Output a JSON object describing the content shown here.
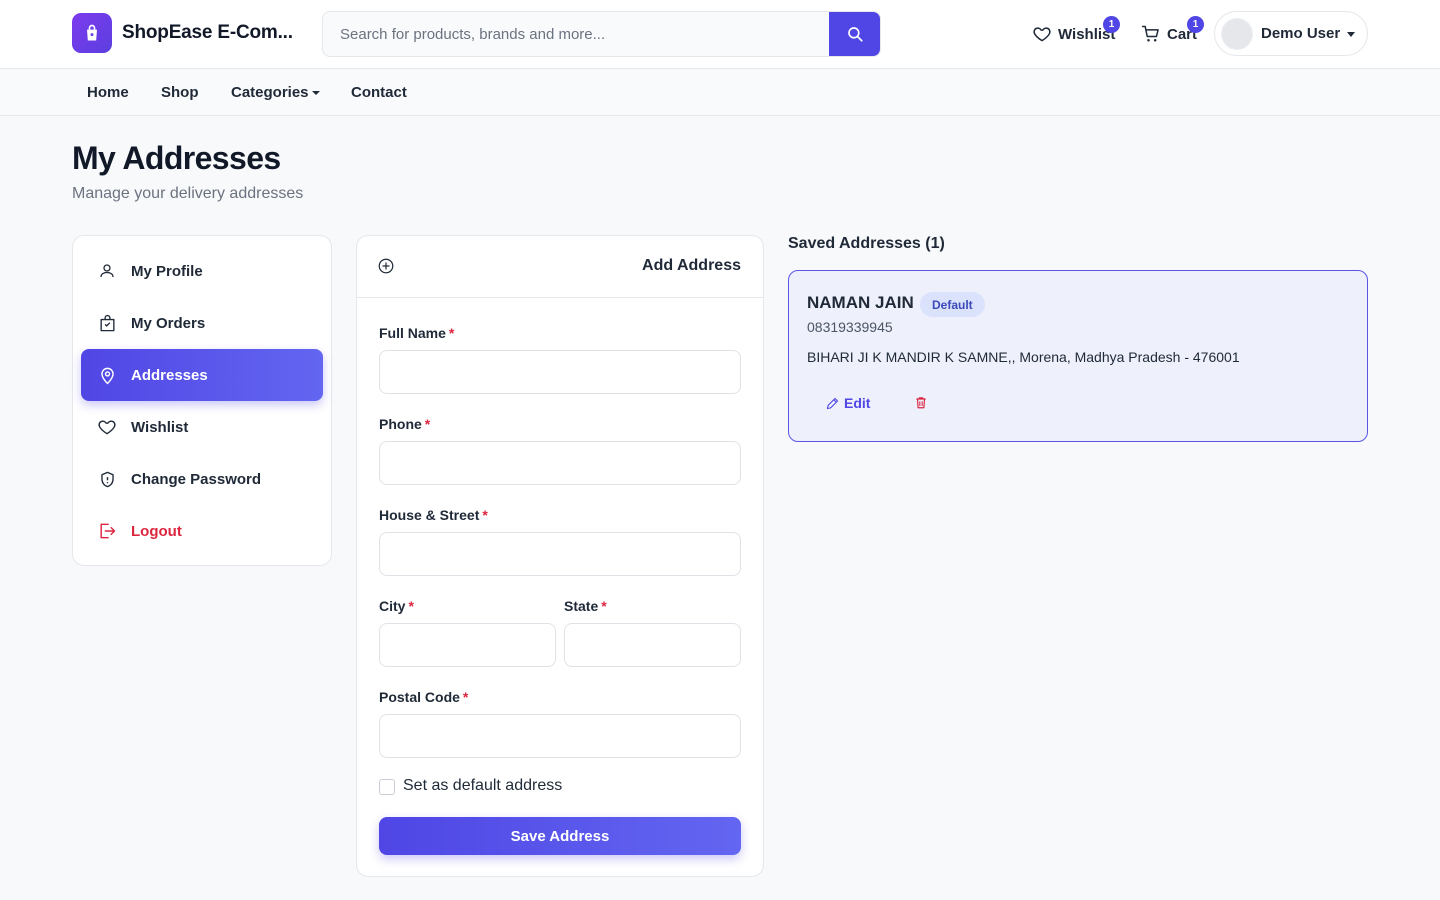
{
  "header": {
    "brand": "ShopEase E-Com...",
    "search_placeholder": "Search for products, brands and more...",
    "wishlist_label": "Wishlist",
    "wishlist_count": "1",
    "cart_label": "Cart",
    "cart_count": "1",
    "user_name": "Demo User"
  },
  "nav": {
    "items": [
      "Home",
      "Shop",
      "Categories",
      "Contact"
    ]
  },
  "page": {
    "title": "My Addresses",
    "subtitle": "Manage your delivery addresses"
  },
  "sidebar": {
    "items": [
      {
        "label": "My Profile",
        "icon": "user-icon"
      },
      {
        "label": "My Orders",
        "icon": "bag-icon"
      },
      {
        "label": "Addresses",
        "icon": "map-pin-icon",
        "active": true
      },
      {
        "label": "Wishlist",
        "icon": "heart-icon"
      },
      {
        "label": "Change Password",
        "icon": "shield-icon"
      },
      {
        "label": "Logout",
        "icon": "logout-icon"
      }
    ]
  },
  "form": {
    "title": "Add Address",
    "full_name_label": "Full Name",
    "phone_label": "Phone",
    "street_label": "House & Street",
    "city_label": "City",
    "state_label": "State",
    "postal_label": "Postal Code",
    "required_mark": "*",
    "default_checkbox_label": "Set as default address",
    "submit_label": "Save Address"
  },
  "saved": {
    "title": "Saved Addresses (1)",
    "addresses": [
      {
        "name": "NAMAN JAIN",
        "badge": "Default",
        "phone": "08319339945",
        "line": "BIHARI JI K MANDIR K SAMNE,, Morena, Madhya Pradesh - 476001",
        "edit_label": "Edit"
      }
    ]
  },
  "colors": {
    "accent": "#4f46e5",
    "danger": "#dc2640",
    "card_highlight": "#eef0fc"
  }
}
